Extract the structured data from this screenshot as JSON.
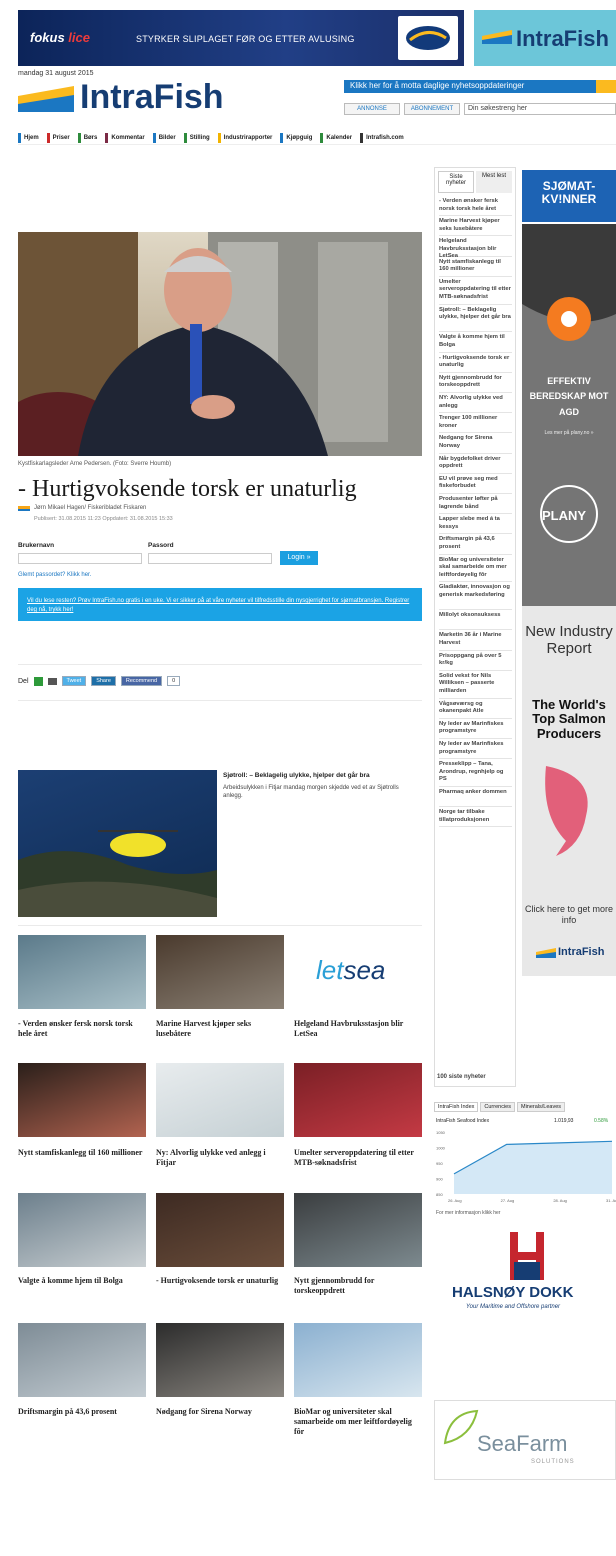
{
  "banner": {
    "fokus": "fokus ",
    "fokus_ice": "lice",
    "message": "STYRKER SLIPLAGET FØR OG ETTER AVLUSING",
    "partner_logo": "BioMar",
    "intrafish_ad": "IntraFish"
  },
  "header": {
    "date": "mandag 31 august 2015",
    "logo": "IntraFish",
    "newsletter_bar": "Klikk her for å motta daglige nyhetsoppdateringer",
    "btn_annonse": "ANNONSE",
    "btn_abonnement": "ABONNEMENT",
    "search_placeholder": "Din søkestreng her"
  },
  "nav": [
    {
      "label": "Hjem",
      "color": "#1b77c2"
    },
    {
      "label": "Priser",
      "color": "#cc2a2a"
    },
    {
      "label": "Børs",
      "color": "#2e8b3c"
    },
    {
      "label": "Kommentar",
      "color": "#7b2a45"
    },
    {
      "label": "Bilder",
      "color": "#1b77c2"
    },
    {
      "label": "Stilling",
      "color": "#2e8b3c"
    },
    {
      "label": "Industrirapporter",
      "color": "#f2b300"
    },
    {
      "label": "Kjøpguig",
      "color": "#1b77c2"
    },
    {
      "label": "Kalender",
      "color": "#2e8b3c"
    },
    {
      "label": "Intrafish.com",
      "color": "#333333"
    }
  ],
  "article": {
    "caption": "Kystfiskarlagsleder Arne Pedersen. (Foto: Sverre Houmb)",
    "title": "- Hurtigvoksende torsk er unaturlig",
    "author": "Jørn Mikael Hagen/ Fiskeribladet Fiskaren",
    "published": "Publisert: 31.08.2015 11:23   Oppdatert: 31.08.2015 15:33"
  },
  "login": {
    "username_label": "Brukernavn",
    "password_label": "Passord",
    "login_button": "Login »",
    "forgot": "Glemt passordet? Klikk her.",
    "promo": "Vil du lese resten? Prøv IntraFish.no gratis i en uke. Vi er sikker på at våre nyheter vil tilfredsstille din nysgjerrighet for sjømatbransjen. Registrer deg nå, trykk her!"
  },
  "share": {
    "del": "Del",
    "tweet": "Tweet",
    "linkedin": "Share",
    "recommend": "Recommend",
    "count": "0"
  },
  "teaser": {
    "title": "Sjøtroll: – Beklagelig ulykke, hjelper det går bra",
    "body": "Arbeidsulykken i Fitjar mandag morgen skjedde ved et av Sjøtrolls anlegg."
  },
  "stories": [
    "- Verden ønsker fersk norsk torsk hele året",
    "Marine Harvest kjøper seks lusebåtere",
    "Helgeland Havbruksstasjon blir LetSea",
    "Nytt stamfiskanlegg til 160 millioner",
    "Ny: Alvorlig ulykke ved anlegg i Fitjar",
    "Umelter serveroppdatering til etter MTB-søknadsfrist",
    "Valgte å komme hjem til Bolga",
    "- Hurtigvoksende torsk er unaturlig",
    "Nytt gjennombrudd for torskeoppdrett",
    "Driftsmargin på 43,6 prosent",
    "Nødgang for Sirena Norway",
    "BioMar og universiteter skal samarbeide om mer leiftfordøyelig fôr"
  ],
  "sidebar": {
    "tab_latest": "Siste nyheter",
    "tab_most_read": "Mest lest",
    "items": [
      "- Verden ønsker fersk norsk torsk hele året",
      "Marine Harvest kjøper seks lusebåtere",
      "Helgeland Havbruksstasjon blir LetSea",
      "Nytt stamfiskanlegg til 160 millioner",
      "Umelter serveroppdatering til etter MTB-søknadsfrist",
      "Sjøtroll: – Beklagelig ulykke, hjelper det går bra",
      "Valgte å komme hjem til Bolga",
      "- Hurtigvoksende torsk er unaturlig",
      "Nytt gjennombrudd for torskeoppdrett",
      "NY: Alvorlig ulykke ved anlegg",
      "Trenger 100 millioner kroner",
      "Nedgang for Sirena Norway",
      "Når bygdefolket driver oppdrett",
      "EU vil prøve seg med fiskeforbudet",
      "Produsenter løfter på lagrende bånd",
      "Lapper slebe med á ta kessys",
      "Driftsmargin på 43,6 prosent",
      "BioMar og universiteter skal samarbeide om mer leiftfordøyelig fôr",
      "Gladiaktør, innovasjon og generisk markedsføring",
      "Millolyt oksonsuksess",
      "Marketin 36 år i Marine Harvest",
      "Prisoppgang på over 5 kr/kg",
      "Solid vekst for Nils Williksen – passerte milliarden",
      "Vågsøværsg og okanenpakt Atle",
      "Ny leder av Marinfiskes programstyre",
      "Ny leder av Marinfiskes programstyre",
      "Presseklipp – Tana, Arondrup, regnhjelp og PS",
      "Pharmaq anker dommen",
      "Norge tar tilbake tillatproduksjonen"
    ],
    "all_link": "100 siste nyheter"
  },
  "ads": {
    "sjomat": "SJØMAT-KV!NNER",
    "plany_text": "EFFEKTIV BEREDSKAP MOT AGD",
    "plany_sub": "Les mer på plany.no »",
    "plany_logo": "PLANY",
    "report_top": "New Industry Report",
    "report_title": "The World's Top Salmon Producers",
    "report_click": "Click here to get more info",
    "report_brand": "IntraFish",
    "halsnoy": "HALSNØY DOKK",
    "halsnoy_sub": "Your Maritime and Offshore partner",
    "seafarm": "SeaFarm",
    "seafarm_sub": "SOLUTIONS"
  },
  "index_widget": {
    "tabs": [
      "IntraFish Index",
      "Currencies",
      "Minerals/Leaves"
    ],
    "row_name": "IntraFish Seafood Index",
    "row_value": "1.019,93",
    "row_change": "0.58%",
    "footer": "For mer informasjon klikk her",
    "chart_data": {
      "type": "area",
      "x": [
        "26. Aug",
        "27. Aug",
        "28. Aug",
        "31. Aug"
      ],
      "y": [
        915,
        1010,
        1015,
        1020
      ],
      "ylim": [
        850,
        1050
      ],
      "yticks": [
        "1050",
        "1000",
        "950",
        "900",
        "850"
      ]
    }
  },
  "colors": {
    "brand_blue": "#163d73",
    "accent_blue": "#1ba3e5",
    "brand_yellow": "#fbba1f"
  }
}
